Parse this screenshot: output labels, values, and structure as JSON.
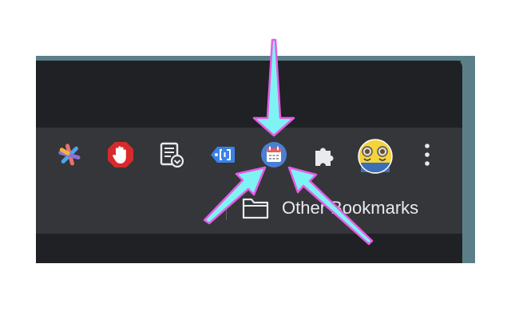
{
  "toolbar": {
    "extensions": [
      {
        "name": "asterisk-extension",
        "icon": "colorful-asterisk-icon"
      },
      {
        "name": "adblock-extension",
        "icon": "red-hand-stop-icon"
      },
      {
        "name": "reading-list-extension",
        "icon": "document-download-icon"
      },
      {
        "name": "tag-extension",
        "icon": "blue-tag-bracket-icon"
      },
      {
        "name": "calendar-extension",
        "icon": "calendar-icon"
      },
      {
        "name": "extensions-menu",
        "icon": "puzzle-icon"
      }
    ],
    "profile_avatar": "minions-avatar",
    "menu_icon": "three-dots-vertical-icon"
  },
  "bookmarks_bar": {
    "other_bookmarks_label": "Other Bookmarks",
    "folder_icon": "folder-icon"
  },
  "annotation": {
    "arrow_fill": "#7ff3f3",
    "arrow_stroke": "#e65ce6"
  },
  "colors": {
    "titlebar": "#202124",
    "toolbar": "#35363a",
    "window_edge": "#5b7f88"
  }
}
